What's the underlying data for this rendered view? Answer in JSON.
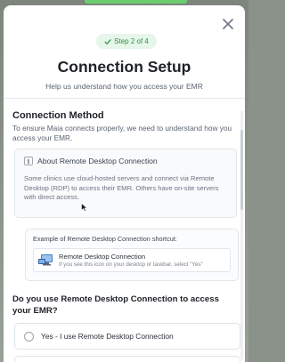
{
  "modal": {
    "step": "Step 2 of 4",
    "title": "Connection Setup",
    "subtitle": "Help us understand how you access your EMR"
  },
  "section": {
    "title": "Connection Method",
    "description": "To ensure Maia connects properly, we need to understand how you access your EMR."
  },
  "about": {
    "heading": "About Remote Desktop Connection",
    "text": "Some clinics use cloud-hosted servers and connect via Remote Desktop (RDP) to access their EMR. Others have on-site servers with direct access."
  },
  "example": {
    "label": "Example of Remote Desktop Connection shortcut:",
    "app_name": "Remote Desktop Connection",
    "hint": "If you see this icon on your desktop or taskbar, select \"Yes\""
  },
  "question": {
    "text": "Do you use Remote Desktop Connection to access your EMR?",
    "options": [
      {
        "label": "Yes - I use Remote Desktop Connection"
      }
    ]
  },
  "icons": {
    "close": "close-icon",
    "check": "check-icon",
    "info": "info-icon",
    "rdp": "remote-desktop-icon",
    "cursor": "mouse-cursor-icon"
  },
  "colors": {
    "accent_green": "#2f8f44",
    "pill_bg": "#e7f6ea",
    "top_bar": "#6bcf6f"
  }
}
